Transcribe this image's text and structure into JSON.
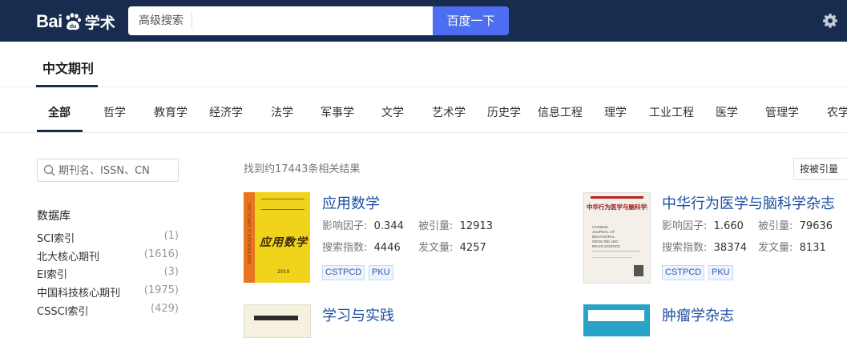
{
  "header": {
    "logo_left": "Bai",
    "logo_right": "学术",
    "adv_search_label": "高级搜索",
    "search_placeholder": "",
    "search_button": "百度一下",
    "settings_icon": "gear-icon"
  },
  "page_title": "中文期刊",
  "tabs": [
    "全部",
    "哲学",
    "教育学",
    "经济学",
    "法学",
    "军事学",
    "文学",
    "艺术学",
    "历史学",
    "信息工程",
    "理学",
    "工业工程",
    "医学",
    "管理学",
    "农学"
  ],
  "active_tab": "全部",
  "filter": {
    "placeholder": "期刊名、ISSN、CN"
  },
  "database": {
    "title": "数据库",
    "items": [
      {
        "name": "SCI索引",
        "count": "(1)"
      },
      {
        "name": "北大核心期刊",
        "count": "(1616)"
      },
      {
        "name": "EI索引",
        "count": "(3)"
      },
      {
        "name": "中国科技核心期刊",
        "count": "(1975)"
      },
      {
        "name": "CSSCI索引",
        "count": "(429)"
      }
    ]
  },
  "results": {
    "count_text": "找到约17443条相关结果",
    "sort_label": "按被引量",
    "journals": [
      {
        "title": "应用数学",
        "impact_label": "影响因子:",
        "impact": "0.344",
        "cited_label": "被引量:",
        "cited": "12913",
        "search_label": "搜索指数:",
        "search": "4446",
        "pubs_label": "发文量:",
        "pubs": "4257",
        "tags": [
          "CSTPCD",
          "PKU"
        ],
        "cover_text": "应用数学",
        "cover_side": "MATHEMATICA APPLICATA",
        "cover_year": "2019"
      },
      {
        "title": "中华行为医学与脑科学杂志",
        "impact_label": "影响因子:",
        "impact": "1.660",
        "cited_label": "被引量:",
        "cited": "79636",
        "search_label": "搜索指数:",
        "search": "38374",
        "pubs_label": "发文量:",
        "pubs": "8131",
        "tags": [
          "CSTPCD",
          "PKU"
        ],
        "cover_text": "中华行为医学与脑科学杂志",
        "cover_en": "CHINESE JOURNAL OF BEHAVIORAL MEDICINE AND BRAIN SCIENCE"
      },
      {
        "title": "学习与实践"
      },
      {
        "title": "肿瘤学杂志"
      }
    ]
  }
}
